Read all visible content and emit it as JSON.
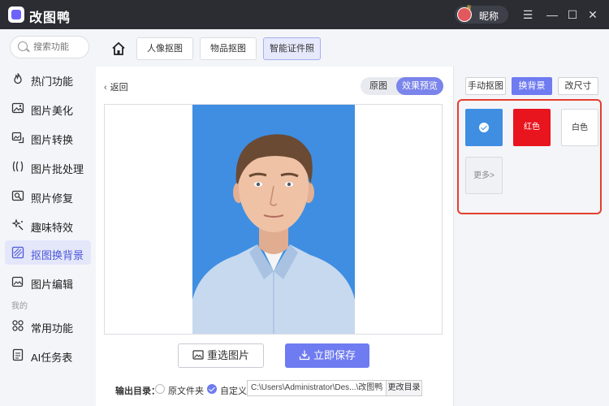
{
  "app": {
    "title": "改图鸭",
    "user_name": "昵称"
  },
  "window_controls": {
    "menu": "☰",
    "minimize": "—",
    "maximize": "☐",
    "close": "✕"
  },
  "sidebar": {
    "search_placeholder": "搜索功能",
    "items": [
      {
        "label": "热门功能",
        "icon": "fire-icon"
      },
      {
        "label": "图片美化",
        "icon": "image-beautify-icon"
      },
      {
        "label": "图片转换",
        "icon": "image-convert-icon"
      },
      {
        "label": "图片批处理",
        "icon": "batch-icon"
      },
      {
        "label": "照片修复",
        "icon": "repair-icon"
      },
      {
        "label": "趣味特效",
        "icon": "sparkle-icon"
      },
      {
        "label": "抠图换背景",
        "icon": "cutout-icon",
        "active": true
      },
      {
        "label": "图片编辑",
        "icon": "edit-icon"
      }
    ],
    "section_mine": "我的",
    "mine_items": [
      {
        "label": "常用功能",
        "icon": "grid-icon"
      },
      {
        "label": "AI任务表",
        "icon": "task-list-icon"
      }
    ]
  },
  "top_tabs": [
    {
      "label": "人像抠图"
    },
    {
      "label": "物品抠图"
    },
    {
      "label": "智能证件照",
      "active": true
    }
  ],
  "center": {
    "back_label": "返回",
    "view_toggle": {
      "original": "原图",
      "preview": "效果预览",
      "active": "preview"
    },
    "reselect_label": "重选图片",
    "save_label": "立即保存",
    "output_label": "输出目录：",
    "option_original_folder": "原文件夹",
    "option_custom": "自定义",
    "output_path": "C:\\Users\\Administrator\\Des...\\改图鸭",
    "change_dir_label": "更改目录"
  },
  "right_panel": {
    "tabs": [
      {
        "label": "手动抠图"
      },
      {
        "label": "换背景",
        "active": true
      },
      {
        "label": "改尺寸"
      }
    ],
    "swatches": [
      {
        "label": "",
        "color": "#3f8ee2",
        "selected": true
      },
      {
        "label": "红色",
        "color": "#e8141e"
      },
      {
        "label": "白色",
        "color": "#ffffff"
      },
      {
        "label": "更多>",
        "color": "#f0f1f4"
      }
    ]
  },
  "colors": {
    "accent": "#6f7bf0",
    "photo_background": "#3f8ee2",
    "highlight_border": "#e53e2f",
    "titlebar": "#2b2d33"
  }
}
